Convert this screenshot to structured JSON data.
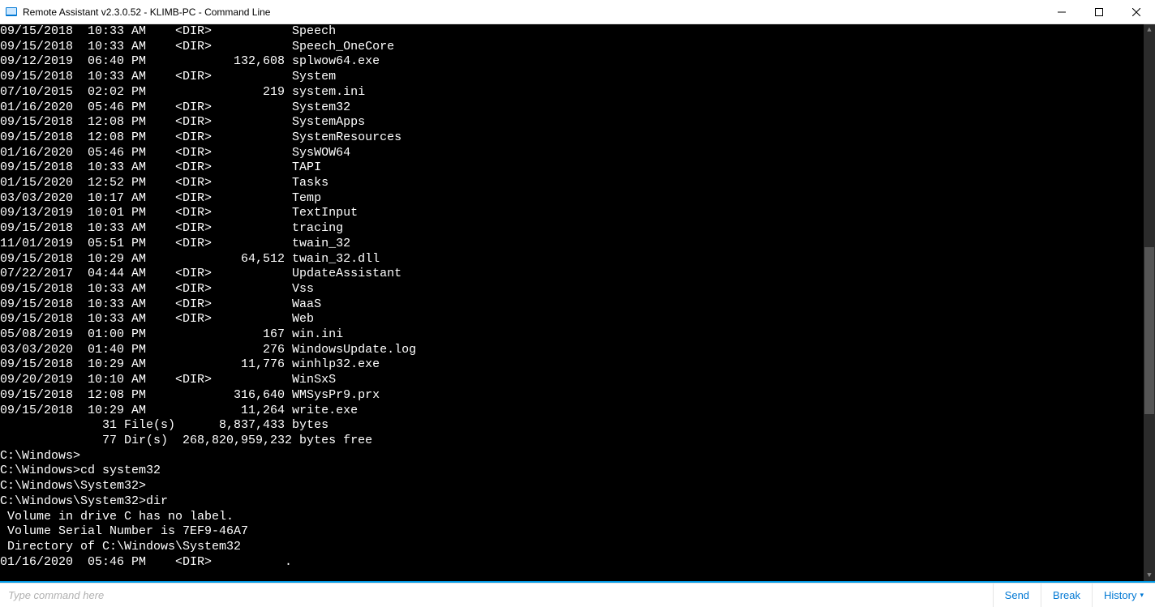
{
  "window": {
    "title": "Remote Assistant v2.3.0.52 - KLIMB-PC - Command Line"
  },
  "terminal": {
    "rows": [
      {
        "date": "09/15/2018",
        "time": "10:33 AM",
        "dir": true,
        "size": "",
        "name": "Speech"
      },
      {
        "date": "09/15/2018",
        "time": "10:33 AM",
        "dir": true,
        "size": "",
        "name": "Speech_OneCore"
      },
      {
        "date": "09/12/2019",
        "time": "06:40 PM",
        "dir": false,
        "size": "132,608",
        "name": "splwow64.exe"
      },
      {
        "date": "09/15/2018",
        "time": "10:33 AM",
        "dir": true,
        "size": "",
        "name": "System"
      },
      {
        "date": "07/10/2015",
        "time": "02:02 PM",
        "dir": false,
        "size": "219",
        "name": "system.ini"
      },
      {
        "date": "01/16/2020",
        "time": "05:46 PM",
        "dir": true,
        "size": "",
        "name": "System32"
      },
      {
        "date": "09/15/2018",
        "time": "12:08 PM",
        "dir": true,
        "size": "",
        "name": "SystemApps"
      },
      {
        "date": "09/15/2018",
        "time": "12:08 PM",
        "dir": true,
        "size": "",
        "name": "SystemResources"
      },
      {
        "date": "01/16/2020",
        "time": "05:46 PM",
        "dir": true,
        "size": "",
        "name": "SysWOW64"
      },
      {
        "date": "09/15/2018",
        "time": "10:33 AM",
        "dir": true,
        "size": "",
        "name": "TAPI"
      },
      {
        "date": "01/15/2020",
        "time": "12:52 PM",
        "dir": true,
        "size": "",
        "name": "Tasks"
      },
      {
        "date": "03/03/2020",
        "time": "10:17 AM",
        "dir": true,
        "size": "",
        "name": "Temp"
      },
      {
        "date": "09/13/2019",
        "time": "10:01 PM",
        "dir": true,
        "size": "",
        "name": "TextInput"
      },
      {
        "date": "09/15/2018",
        "time": "10:33 AM",
        "dir": true,
        "size": "",
        "name": "tracing"
      },
      {
        "date": "11/01/2019",
        "time": "05:51 PM",
        "dir": true,
        "size": "",
        "name": "twain_32"
      },
      {
        "date": "09/15/2018",
        "time": "10:29 AM",
        "dir": false,
        "size": "64,512",
        "name": "twain_32.dll"
      },
      {
        "date": "07/22/2017",
        "time": "04:44 AM",
        "dir": true,
        "size": "",
        "name": "UpdateAssistant"
      },
      {
        "date": "09/15/2018",
        "time": "10:33 AM",
        "dir": true,
        "size": "",
        "name": "Vss"
      },
      {
        "date": "09/15/2018",
        "time": "10:33 AM",
        "dir": true,
        "size": "",
        "name": "WaaS"
      },
      {
        "date": "09/15/2018",
        "time": "10:33 AM",
        "dir": true,
        "size": "",
        "name": "Web"
      },
      {
        "date": "05/08/2019",
        "time": "01:00 PM",
        "dir": false,
        "size": "167",
        "name": "win.ini"
      },
      {
        "date": "03/03/2020",
        "time": "01:40 PM",
        "dir": false,
        "size": "276",
        "name": "WindowsUpdate.log"
      },
      {
        "date": "09/15/2018",
        "time": "10:29 AM",
        "dir": false,
        "size": "11,776",
        "name": "winhlp32.exe"
      },
      {
        "date": "09/20/2019",
        "time": "10:10 AM",
        "dir": true,
        "size": "",
        "name": "WinSxS"
      },
      {
        "date": "09/15/2018",
        "time": "12:08 PM",
        "dir": false,
        "size": "316,640",
        "name": "WMSysPr9.prx"
      },
      {
        "date": "09/15/2018",
        "time": "10:29 AM",
        "dir": false,
        "size": "11,264",
        "name": "write.exe"
      }
    ],
    "summary": {
      "files_line": "              31 File(s)      8,837,433 bytes",
      "dirs_line": "              77 Dir(s)  268,820,959,232 bytes free"
    },
    "trailing": [
      "C:\\Windows>",
      "C:\\Windows>cd system32",
      "C:\\Windows\\System32>",
      "C:\\Windows\\System32>dir",
      " Volume in drive C has no label.",
      " Volume Serial Number is 7EF9-46A7",
      " Directory of C:\\Windows\\System32",
      "01/16/2020  05:46 PM    <DIR>          ."
    ]
  },
  "footer": {
    "placeholder": "Type command here",
    "send": "Send",
    "break": "Break",
    "history": "History"
  }
}
